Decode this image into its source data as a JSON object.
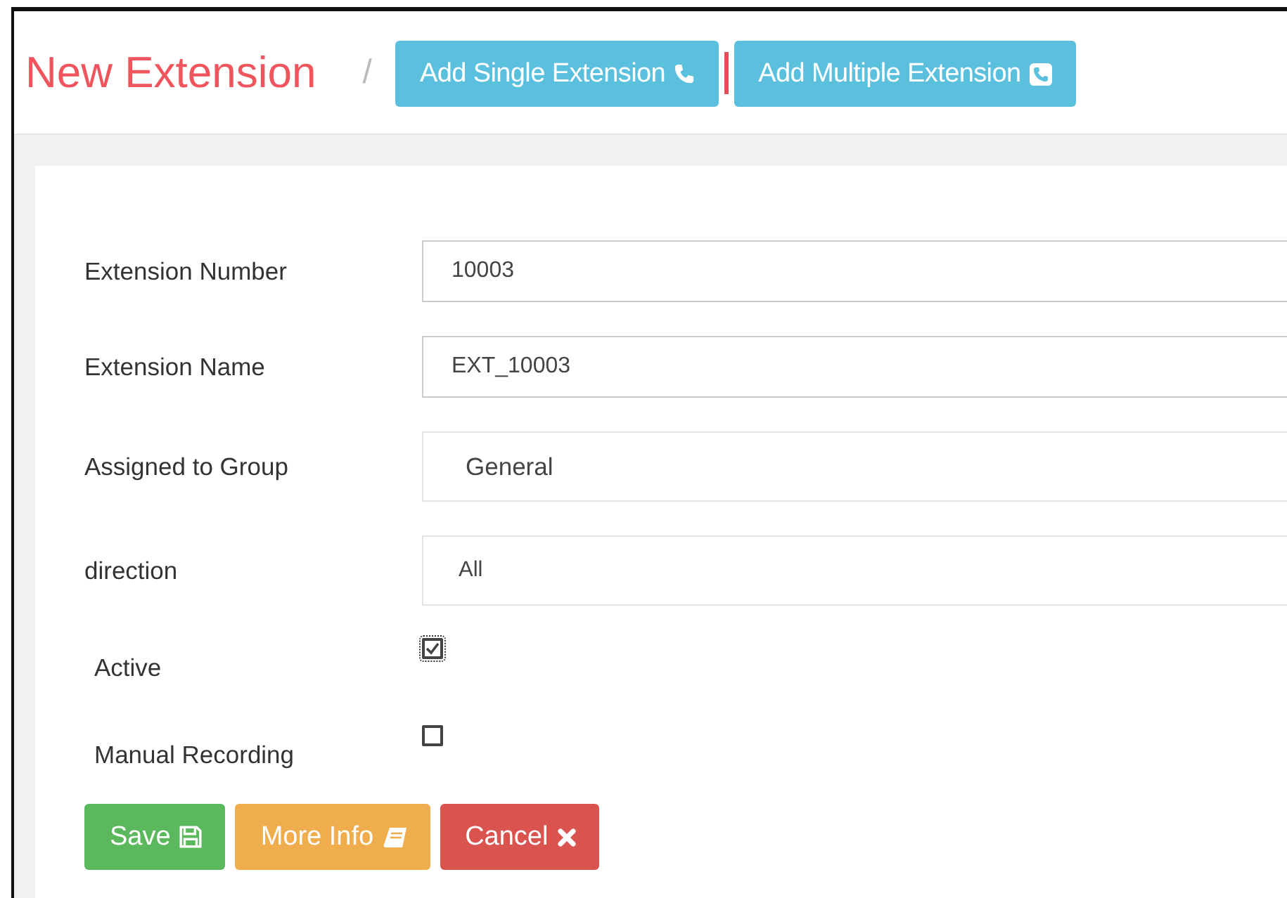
{
  "header": {
    "title": "New Extension",
    "separator": "/",
    "tabs": [
      {
        "label": "Add Single Extension"
      },
      {
        "label": "Add Multiple Extension"
      }
    ]
  },
  "form": {
    "fields": [
      {
        "kind": "input",
        "label": "Extension Number",
        "value": "10003"
      },
      {
        "kind": "input",
        "label": "Extension Name",
        "value": "EXT_10003"
      },
      {
        "kind": "select",
        "label": "Assigned to Group",
        "value": "General"
      },
      {
        "kind": "select",
        "label": "direction",
        "value": "All"
      },
      {
        "kind": "checkbox",
        "label": "Active",
        "checked": true
      },
      {
        "kind": "checkbox",
        "label": "Manual Recording",
        "checked": false
      }
    ],
    "buttons": [
      {
        "kind": "save",
        "label": "Save"
      },
      {
        "kind": "info",
        "label": "More Info"
      },
      {
        "kind": "cancel",
        "label": "Cancel"
      }
    ]
  }
}
